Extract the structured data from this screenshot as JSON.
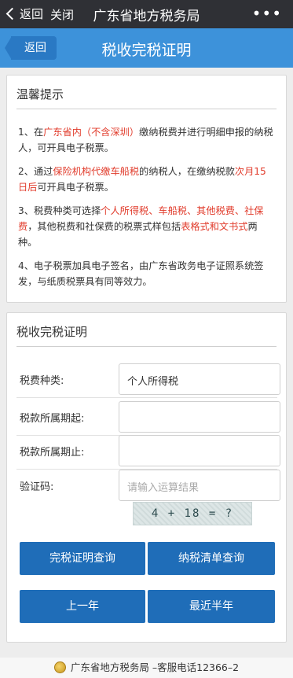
{
  "topbar": {
    "back_label": "返回",
    "close_label": "关闭",
    "title": "广东省地方税务局",
    "more_label": "•••"
  },
  "header": {
    "back_label": "返回",
    "title": "税收完税证明"
  },
  "tips": {
    "title": "温馨提示",
    "items": [
      {
        "prefix": "1、在",
        "highlight": "广东省内（不含深圳）",
        "suffix": "缴纳税费并进行明细申报的纳税人，可开具电子税票。"
      },
      {
        "prefix": "2、通过",
        "highlight": "保险机构代缴车船税",
        "middle": "的纳税人，在缴纳税款",
        "highlight2": "次月15日后",
        "suffix": "可开具电子税票。"
      },
      {
        "prefix": "3、税费种类可选择",
        "highlight": "个人所得税、车船税、其他税费、社保费",
        "middle": "，其他税费和社保费的税票式样包括",
        "highlight2": "表格式和文书式",
        "suffix": "两种。"
      },
      {
        "prefix": "4、电子税票加具电子签名，由广东省政务电子证照系统签发，与纸质税票具有同等效力。"
      }
    ]
  },
  "form": {
    "title": "税收完税证明",
    "tax_type_label": "税费种类:",
    "tax_type_value": "个人所得税",
    "period_start_label": "税款所属期起:",
    "period_start_value": "",
    "period_end_label": "税款所属期止:",
    "period_end_value": "",
    "captcha_label": "验证码:",
    "captcha_placeholder": "请输入运算结果",
    "captcha_text": "4 + 18 = ?",
    "btn_query_certificate": "完税证明查询",
    "btn_query_list": "纳税清单查询",
    "btn_last_year": "上一年",
    "btn_last_half_year": "最近半年"
  },
  "footer": {
    "text": "广东省地方税务局 –客服电话12366–2"
  },
  "colors": {
    "header_blue": "#3d92da",
    "button_blue": "#1f6db8",
    "highlight_red": "#e13b2b",
    "topbar_dark": "#2f3035"
  }
}
